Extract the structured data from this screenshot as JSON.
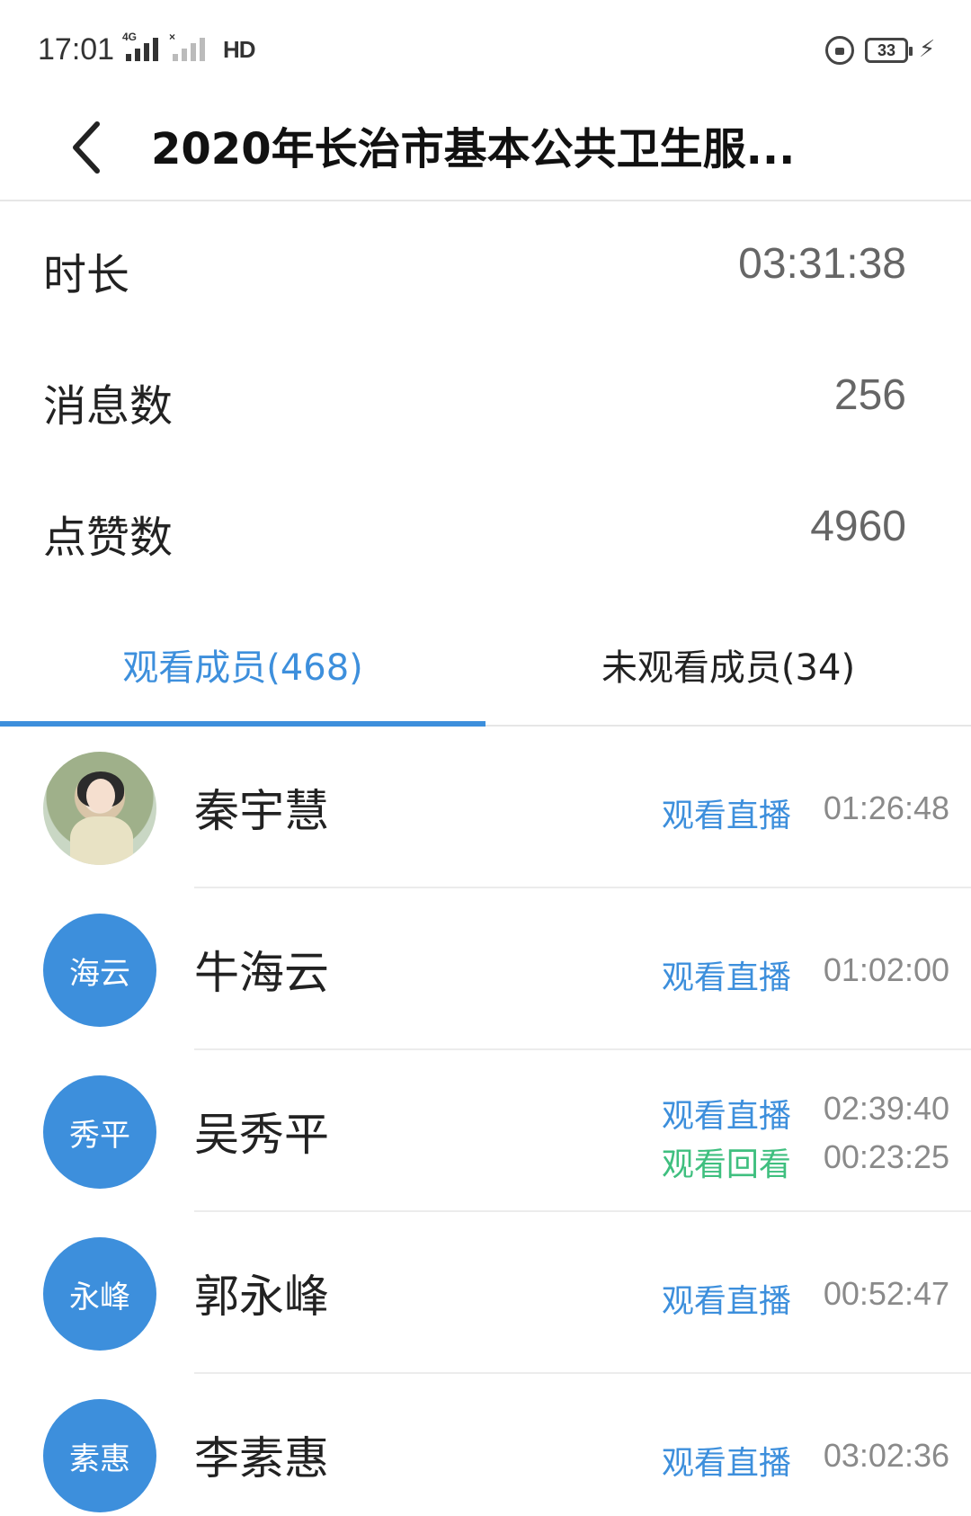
{
  "status_bar": {
    "time": "17:01",
    "network_label": "4G",
    "hd_label": "HD",
    "battery_level": "33"
  },
  "nav": {
    "title": "2020年长治市基本公共卫生服..."
  },
  "stats": [
    {
      "label": "时长",
      "value": "03:31:38"
    },
    {
      "label": "消息数",
      "value": "256"
    },
    {
      "label": "点赞数",
      "value": "4960"
    }
  ],
  "tabs": [
    {
      "label": "观看成员(468)",
      "active": true
    },
    {
      "label": "未观看成员(34)",
      "active": false
    }
  ],
  "members": [
    {
      "name": "秦宇慧",
      "avatar_text": "",
      "avatar_type": "photo",
      "records": [
        {
          "type": "观看直播",
          "time": "01:26:48"
        }
      ]
    },
    {
      "name": "牛海云",
      "avatar_text": "海云",
      "avatar_type": "initials",
      "records": [
        {
          "type": "观看直播",
          "time": "01:02:00"
        }
      ]
    },
    {
      "name": "吴秀平",
      "avatar_text": "秀平",
      "avatar_type": "initials",
      "records": [
        {
          "type": "观看直播",
          "time": "02:39:40"
        },
        {
          "type": "观看回看",
          "time": "00:23:25"
        }
      ]
    },
    {
      "name": "郭永峰",
      "avatar_text": "永峰",
      "avatar_type": "initials",
      "records": [
        {
          "type": "观看直播",
          "time": "00:52:47"
        }
      ]
    },
    {
      "name": "李素惠",
      "avatar_text": "素惠",
      "avatar_type": "initials",
      "records": [
        {
          "type": "观看直播",
          "time": "03:02:36"
        }
      ]
    }
  ],
  "colors": {
    "accent": "#3d8fdc",
    "replay": "#3fbf7f"
  }
}
